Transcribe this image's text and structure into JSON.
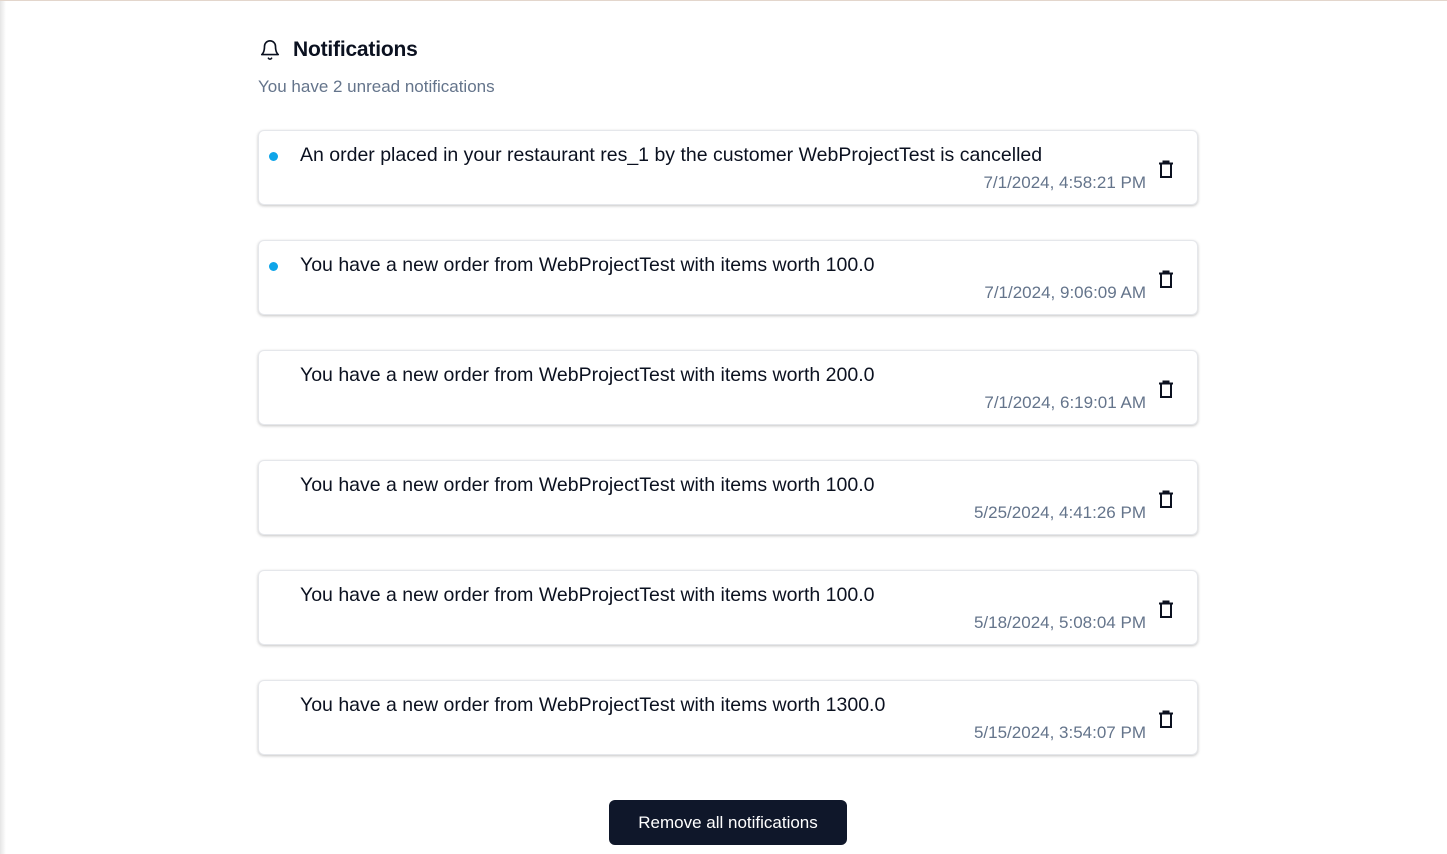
{
  "header": {
    "title": "Notifications",
    "icon": "bell-icon",
    "subtitle": "You have 2 unread notifications"
  },
  "notifications": [
    {
      "message": "An order placed in your restaurant res_1 by the customer WebProjectTest is cancelled",
      "timestamp": "7/1/2024, 4:58:21 PM",
      "unread": true
    },
    {
      "message": "You have a new order from WebProjectTest with items worth 100.0",
      "timestamp": "7/1/2024, 9:06:09 AM",
      "unread": true
    },
    {
      "message": "You have a new order from WebProjectTest with items worth 200.0",
      "timestamp": "7/1/2024, 6:19:01 AM",
      "unread": false
    },
    {
      "message": "You have a new order from WebProjectTest with items worth 100.0",
      "timestamp": "5/25/2024, 4:41:26 PM",
      "unread": false
    },
    {
      "message": "You have a new order from WebProjectTest with items worth 100.0",
      "timestamp": "5/18/2024, 5:08:04 PM",
      "unread": false
    },
    {
      "message": "You have a new order from WebProjectTest with items worth 1300.0",
      "timestamp": "5/15/2024, 3:54:07 PM",
      "unread": false
    }
  ],
  "actions": {
    "remove_all_label": "Remove all notifications"
  },
  "colors": {
    "unread_dot": "#0ea5e9",
    "button_bg": "#0f172a",
    "muted_text": "#64748b"
  }
}
